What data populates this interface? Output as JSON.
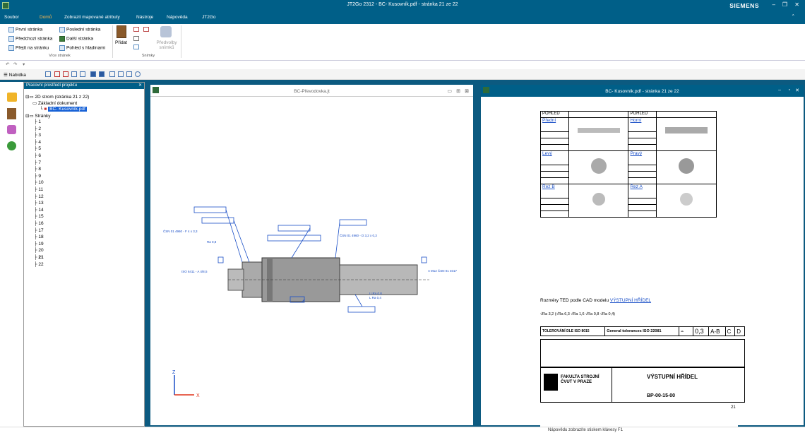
{
  "titlebar": {
    "title": "JT2Go 2312 - BC- Kusovník.pdf - stránka 21 ze 22",
    "brand": "SIEMENS"
  },
  "menu": [
    "Soubor",
    "Domů",
    "Zobrazit mapované atributy",
    "Nástroje",
    "Nápověda",
    "JT2Go"
  ],
  "ribbon": {
    "pages": [
      "První stránka",
      "Poslední stránka",
      "Předchozí stránka",
      "Další stránka",
      "Přejít na stránku",
      "Pohled s hladinami"
    ],
    "group_pages": "Více stránek",
    "add": "Přidat",
    "presets": "Předvolby snímků",
    "group_snap": "Snímky"
  },
  "toolbar2": {
    "menu_label": "☰ Nabídka"
  },
  "project_panel": {
    "title": "Pracovní prostředí projektu",
    "root": "2D strom (stránka 21 z 22)",
    "base_doc": "Základní dokument",
    "selected": "BC- Kusovník.pdf",
    "pages_label": "Stránky",
    "pages": [
      "1",
      "2",
      "3",
      "4",
      "5",
      "6",
      "7",
      "8",
      "9",
      "10",
      "11",
      "12",
      "13",
      "14",
      "15",
      "16",
      "17",
      "18",
      "19",
      "20",
      "21",
      "22"
    ]
  },
  "window1": {
    "title": "BC-Převodovka.jt",
    "axis_z": "Z",
    "axis_x": "X"
  },
  "window2": {
    "title": "BC- Kusovník.pdf - stránka 21 ze 22",
    "view_head": "POHLED",
    "views": [
      "Přední",
      "Horní",
      "Levý",
      "Pravý",
      "Řez B",
      "Řez A"
    ],
    "ted_text": "Rozměry TED podle CAD modelu",
    "ted_link": "VÝSTUPNÍ HŘÍDEL",
    "roughness": [
      "Ra 3,2",
      "Ra 6,3",
      "Ra 1,6",
      "Ra 0,8",
      "Ra 0,4"
    ],
    "tol_iso": "TOLEROVÁNÍ DLE ISO 8015",
    "gen_tol": "General tolerances ISO 22081",
    "tol_val": "0,3",
    "datum": [
      "A-B",
      "C",
      "D"
    ],
    "part_name": "VÝSTUPNÍ HŘÍDEL",
    "part_no": "BP-00-15-00",
    "faculty": "FAKULTA STROJNÍ ČVUT V PRAZE",
    "page_no": "21"
  },
  "status": {
    "text": "Nápovědu zobrazíte stiskem klávesy F1"
  }
}
